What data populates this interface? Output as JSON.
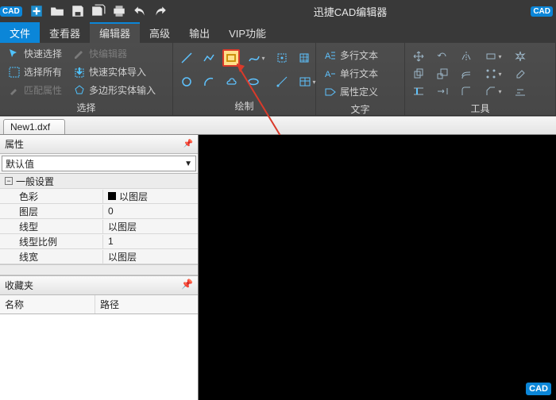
{
  "app": {
    "title": "迅捷CAD编辑器",
    "badge_left": "CAD",
    "badge_right": "CAD"
  },
  "menubar": {
    "file": "文件",
    "items": [
      "查看器",
      "编辑器",
      "高级",
      "输出",
      "VIP功能"
    ],
    "active_index": 1
  },
  "ribbon": {
    "select": {
      "label": "选择",
      "quick_select": "快速选择",
      "select_all": "选择所有",
      "match_props": "匹配属性",
      "quick_editor": "快编辑器",
      "entity_import": "快速实体导入",
      "polygon_input": "多边形实体输入"
    },
    "draw": {
      "label": "绘制"
    },
    "text": {
      "label": "文字",
      "mtext": "多行文本",
      "stext": "单行文本",
      "attrdef": "属性定义"
    },
    "tools": {
      "label": "工具"
    }
  },
  "doc": {
    "tab": "New1.dxf"
  },
  "props": {
    "title": "属性",
    "combo": "默认值",
    "section": "一般设置",
    "rows": [
      {
        "k": "色彩",
        "v": "以图层",
        "swatch": true
      },
      {
        "k": "图层",
        "v": "0"
      },
      {
        "k": "线型",
        "v": "以图层"
      },
      {
        "k": "线型比例",
        "v": "1"
      },
      {
        "k": "线宽",
        "v": "以图层"
      }
    ]
  },
  "fav": {
    "title": "收藏夹",
    "col_name": "名称",
    "col_path": "路径"
  },
  "annotation": {
    "text": "矩形"
  }
}
